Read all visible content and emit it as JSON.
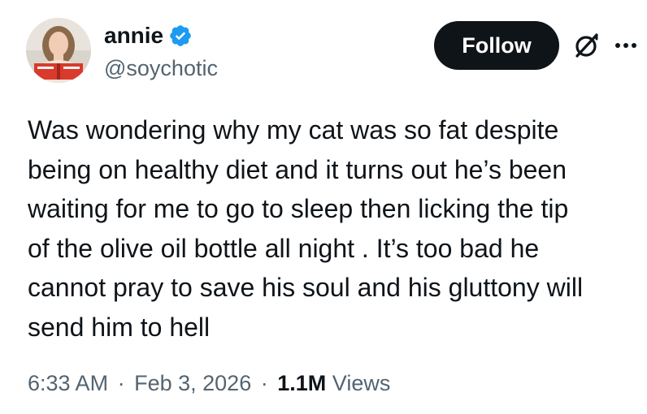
{
  "author": {
    "display_name": "annie",
    "handle": "@soychotic",
    "verified": true,
    "verified_color": "#1d9bf0"
  },
  "actions": {
    "follow_label": "Follow"
  },
  "tweet": {
    "text": "Was wondering why my cat was so fat despite\nbeing on healthy diet and it turns out he’s been\nwaiting for me to go to sleep then licking the tip\nof the olive oil bottle all night . It’s too bad he\ncannot pray to save his soul and his gluttony will\nsend him to hell"
  },
  "meta": {
    "time": "6:33 AM",
    "separator": "·",
    "date": "Feb 3, 2026",
    "views_count": "1.1M",
    "views_label": "Views"
  },
  "colors": {
    "text_primary": "#0f1419",
    "text_secondary": "#536471",
    "button_bg": "#0f1419"
  }
}
